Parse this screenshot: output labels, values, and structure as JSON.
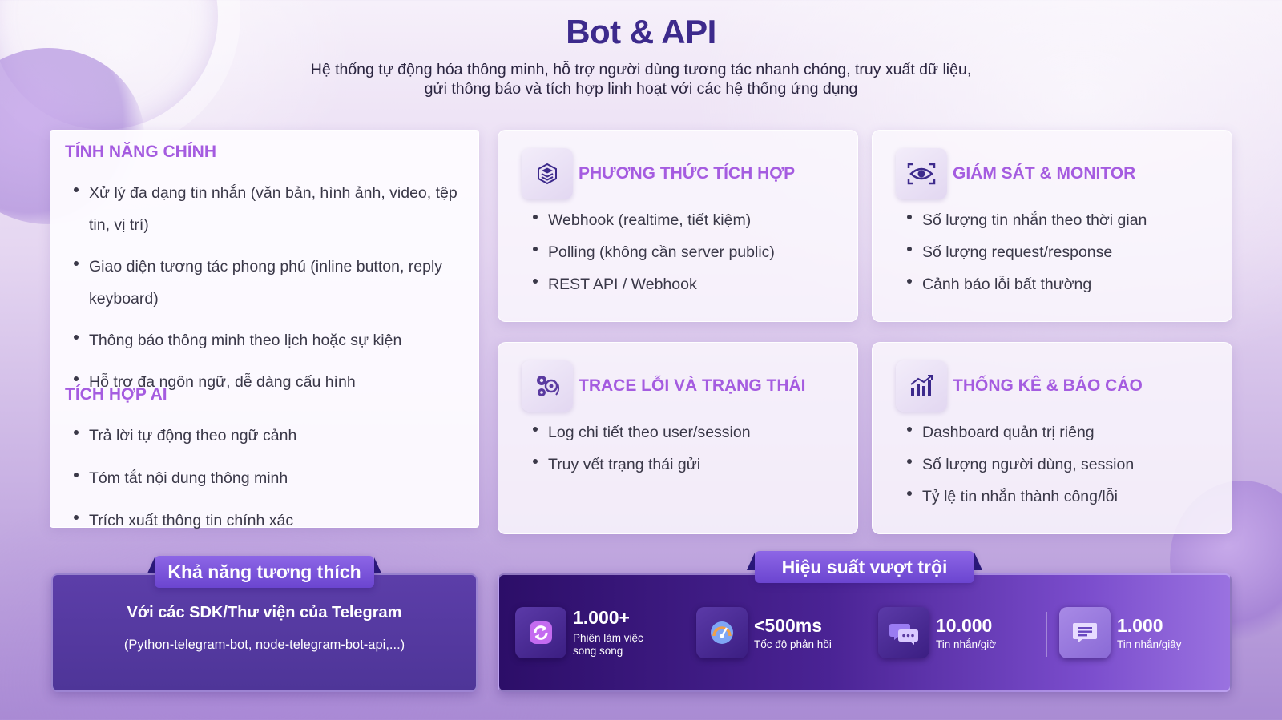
{
  "header": {
    "title": "Bot & API",
    "subtitle_line1": "Hệ thống tự động hóa thông minh, hỗ trợ người dùng tương tác nhanh chóng, truy xuất dữ liệu,",
    "subtitle_line2": "gửi thông báo và tích hợp linh hoạt với các hệ thống ứng dụng"
  },
  "features": {
    "title": "TÍNH NĂNG CHÍNH",
    "items": [
      "Xử lý đa dạng tin nhắn (văn bản, hình ảnh, video, tệp tin, vị trí)",
      "Giao diện tương tác phong phú (inline button, reply keyboard)",
      "Thông báo thông minh theo lịch hoặc sự kiện",
      "Hỗ trợ đa ngôn ngữ, dễ dàng cấu hình"
    ]
  },
  "ai": {
    "title": "TÍCH HỢP AI",
    "items": [
      "Trả lời tự động theo ngữ cảnh",
      "Tóm tắt nội dung thông minh",
      "Trích xuất thông tin chính xác"
    ]
  },
  "cards": {
    "integration": {
      "title": "PHƯƠNG THỨC TÍCH HỢP",
      "icon": "layers-icon",
      "items": [
        "Webhook (realtime, tiết kiệm)",
        "Polling (không cần server public)",
        "REST API / Webhook"
      ]
    },
    "monitor": {
      "title": "GIÁM SÁT & MONITOR",
      "icon": "eye-scan-icon",
      "items": [
        "Số lượng tin nhắn theo thời gian",
        "Số lượng request/response",
        "Cảnh báo lỗi bất thường"
      ]
    },
    "trace": {
      "title": "TRACE LỖI VÀ TRẠNG THÁI",
      "icon": "gears-icon",
      "items": [
        "Log chi tiết theo user/session",
        "Truy vết trạng thái gửi"
      ]
    },
    "stats": {
      "title": "THỐNG KÊ & BÁO CÁO",
      "icon": "bar-chart-icon",
      "items": [
        "Dashboard quản trị riêng",
        "Số lượng người dùng, session",
        "Tỷ lệ tin nhắn thành công/lỗi"
      ]
    }
  },
  "compatibility": {
    "label": "Khả năng tương thích",
    "line1": "Với các SDK/Thư viện của Telegram",
    "line2": "(Python-telegram-bot, node-telegram-bot-api,...)"
  },
  "performance": {
    "label": "Hiệu suất vượt trội",
    "stats": [
      {
        "value": "1.000+",
        "label1": "Phiên làm việc",
        "label2": "song song",
        "icon": "sync-icon"
      },
      {
        "value": "<500ms",
        "label1": "Tốc độ phản hồi",
        "label2": "",
        "icon": "speedometer-icon"
      },
      {
        "value": "10.000",
        "label1": "Tin nhắn/giờ",
        "label2": "",
        "icon": "chat-bubbles-icon"
      },
      {
        "value": "1.000",
        "label1": "Tin nhắn/giây",
        "label2": "",
        "icon": "message-icon"
      }
    ]
  },
  "colors": {
    "title": "#3d2a8c",
    "accent": "#a55ce0",
    "panel_dark": "#4e3598",
    "tab": "#7a55dc"
  }
}
